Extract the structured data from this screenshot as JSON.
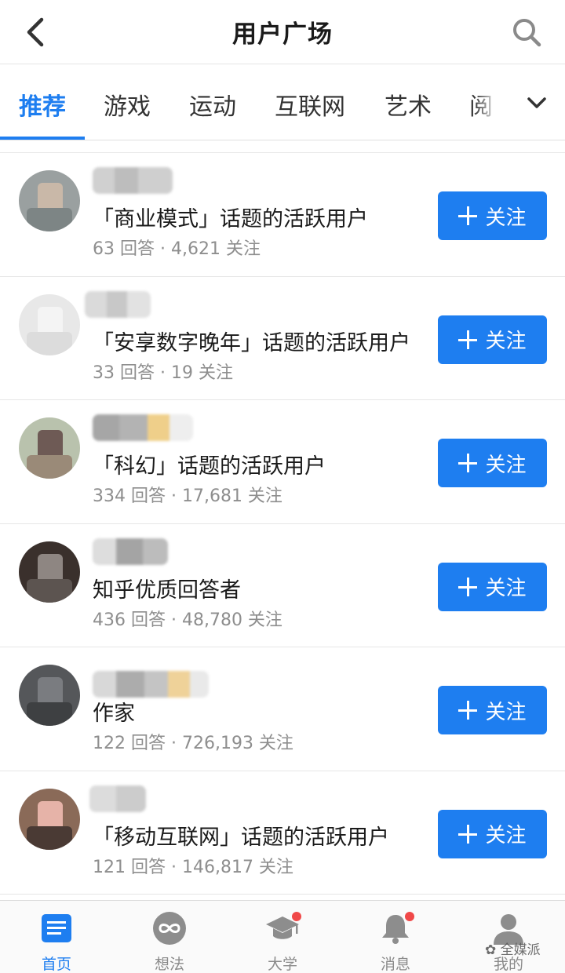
{
  "header": {
    "title": "用户广场"
  },
  "tabs": [
    "推荐",
    "游戏",
    "运动",
    "互联网",
    "艺术",
    "阅"
  ],
  "active_tab": "推荐",
  "users": [
    {
      "desc": "「商业模式」话题的活跃用户",
      "stats": "63 回答 · 4,621 关注",
      "follow_label": "关注"
    },
    {
      "desc": "「安享数字晚年」话题的活跃用户",
      "stats": "33 回答 · 19 关注",
      "follow_label": "关注"
    },
    {
      "desc": "「科幻」话题的活跃用户",
      "stats": "334 回答 · 17,681 关注",
      "follow_label": "关注"
    },
    {
      "desc": "知乎优质回答者",
      "stats": "436 回答 · 48,780 关注",
      "follow_label": "关注"
    },
    {
      "desc": "作家",
      "stats": "122 回答 · 726,193 关注",
      "follow_label": "关注"
    },
    {
      "desc": "「移动互联网」话题的活跃用户",
      "stats": "121 回答 · 146,817 关注",
      "follow_label": "关注"
    }
  ],
  "bottom_nav": [
    {
      "label": "首页",
      "icon": "home-list-icon",
      "active": true
    },
    {
      "label": "想法",
      "icon": "infinity-icon"
    },
    {
      "label": "大学",
      "icon": "graduation-cap-icon",
      "badge": true
    },
    {
      "label": "消息",
      "icon": "bell-icon",
      "badge": true
    },
    {
      "label": "我的",
      "icon": "person-icon"
    }
  ],
  "watermark": "全媒派",
  "colors": {
    "accent": "#1e7ef0",
    "badge": "#f04848",
    "secondary_text": "#8e8e8e"
  }
}
